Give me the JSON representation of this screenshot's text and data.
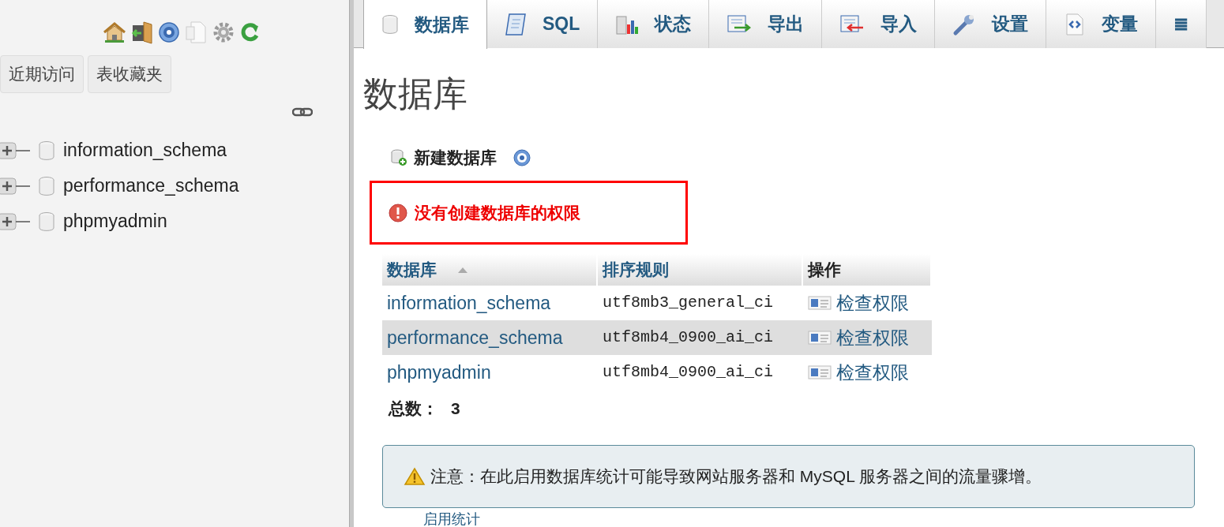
{
  "sidebar": {
    "buttons": [
      "近期访问",
      "表收藏夹"
    ],
    "tree": [
      {
        "label": "information_schema",
        "expanded": false
      },
      {
        "label": "performance_schema",
        "expanded": false
      },
      {
        "label": "phpmyadmin",
        "expanded": false
      }
    ]
  },
  "tabs": [
    {
      "label": "数据库",
      "selected": true
    },
    {
      "label": "SQL",
      "selected": false
    },
    {
      "label": "状态",
      "selected": false
    },
    {
      "label": "导出",
      "selected": false
    },
    {
      "label": "导入",
      "selected": false
    },
    {
      "label": "设置",
      "selected": false
    },
    {
      "label": "变量",
      "selected": false
    },
    {
      "label": "≣",
      "selected": false
    }
  ],
  "page_title": "数据库",
  "create_database": "新建数据库",
  "error_message": "没有创建数据库的权限",
  "table": {
    "columns": [
      {
        "label": "数据库",
        "sorted": true
      },
      {
        "label": "排序规则",
        "sorted": false
      },
      {
        "label": "操作",
        "sorted": false
      }
    ],
    "rows": [
      {
        "database": "information_schema",
        "collation": "utf8mb3_general_ci",
        "action": "检查权限",
        "selected": false
      },
      {
        "database": "performance_schema",
        "collation": "utf8mb4_0900_ai_ci",
        "action": "检查权限",
        "selected": true
      },
      {
        "database": "phpmyadmin",
        "collation": "utf8mb4_0900_ai_ci",
        "action": "检查权限",
        "selected": false
      }
    ]
  },
  "total_label": "总数：",
  "total_value": "3",
  "notice": "注意：在此启用数据库统计可能导致网站服务器和 MySQL 服务器之间的流量骤增。",
  "enable_statistics": "启用统计"
}
